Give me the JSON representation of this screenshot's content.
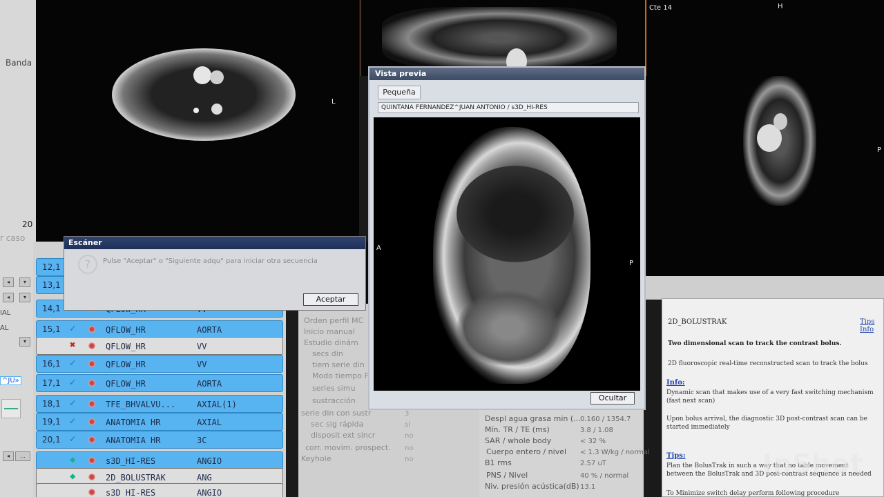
{
  "left_strip": {
    "banda_label": "Banda",
    "num_20": "20",
    "caso_label": "r caso",
    "axial_label": "IAL",
    "al_label": "AL",
    "ju_label": "^JU»"
  },
  "viewports": {
    "axial": {
      "orient_label": "L"
    },
    "sagittal": {
      "orient_left": "A",
      "orient_right": "P"
    },
    "right": {
      "corner_label": "Cte 14",
      "top_label": "H",
      "orient_right": "P"
    }
  },
  "vista_previa": {
    "title": "Vista previa",
    "tab": "Pequeña",
    "patient": "QUINTANA FERNANDEZ^JUAN ANTONIO / s3D_HI-RES",
    "hide_button": "Ocultar"
  },
  "escaner": {
    "title": "Escáner",
    "message": "Pulse \"Aceptar\" o \"Siguiente adqu\" para iniciar otra secuencia",
    "accept_button": "Aceptar"
  },
  "scan_rows": [
    {
      "num": "12,1",
      "status": "",
      "name": "",
      "tag": "",
      "selected": true
    },
    {
      "num": "13,1",
      "status": "",
      "name": "",
      "tag": "",
      "selected": true
    },
    {
      "num": "14,1",
      "status": "✓",
      "name": "QFLOW_HR",
      "tag": "VV",
      "selected": true
    },
    {
      "num": "15,1",
      "status": "✓",
      "name": "QFLOW_HR",
      "tag": "AORTA",
      "selected": true
    },
    {
      "num": "",
      "status": "✖",
      "name": "QFLOW_HR",
      "tag": "VV",
      "selected": false
    },
    {
      "num": "16,1",
      "status": "✓",
      "name": "QFLOW_HR",
      "tag": "VV",
      "selected": true
    },
    {
      "num": "17,1",
      "status": "✓",
      "name": "QFLOW_HR",
      "tag": "AORTA",
      "selected": true
    },
    {
      "num": "18,1",
      "status": "✓",
      "name": "TFE_BHVALVU...",
      "tag": "AXIAL(1)",
      "selected": true
    },
    {
      "num": "19,1",
      "status": "✓",
      "name": "ANATOMIA HR",
      "tag": "AXIAL",
      "selected": true
    },
    {
      "num": "20,1",
      "status": "✓",
      "name": "ANATOMIA HR",
      "tag": "3C",
      "selected": true
    },
    {
      "num": "",
      "status": "◆",
      "name": "s3D_HI-RES",
      "tag": "ANGIO",
      "selected": true
    },
    {
      "num": "",
      "status": "◆",
      "name": "2D_BOLUSTRAK",
      "tag": "ANG",
      "selected": false
    },
    {
      "num": "",
      "status": "",
      "name": "s3D_HI-RES",
      "tag": "ANGIO",
      "selected": false
    }
  ],
  "params_left": [
    "Orden perfil MC",
    "Inicio manual",
    "Estudio dinám",
    "secs din",
    "tiem serie din",
    "Modo tiempo F",
    "series simu",
    "sustracción",
    "serie din con sustr",
    "sec sig rápida",
    "disposit ext sincr",
    "corr. movim. prospect.",
    "Keyhole"
  ],
  "params_left_vals": [
    "3",
    "sí",
    "no",
    "no",
    "no"
  ],
  "params_right": [
    {
      "label": "Despl agua grasa min (...",
      "value": "0.160 / 1354.7"
    },
    {
      "label": "Mín. TR / TE (ms)",
      "value": "3.8 / 1.08"
    },
    {
      "label": "SAR / whole body",
      "value": "< 32 %"
    },
    {
      "label": "Cuerpo entero / nivel",
      "value": "< 1.3 W/kg / normal"
    },
    {
      "label": "B1 rms",
      "value": "2.57 uT"
    },
    {
      "label": "PNS / Nivel",
      "value": "40 % / normal"
    },
    {
      "label": "Niv. presión acústica(dB)",
      "value": "13.1"
    }
  ],
  "help": {
    "title": "2D_BOLUSTRAK",
    "tips_link": "Tips Info",
    "subtitle": "Two dimensional scan to track the contrast bolus.",
    "desc": "2D fluoroscopic real-time reconstructed scan to track the bolus",
    "info_label": "Info:",
    "info_text": "Dynamic scan that makes use of a very fast switching mechanism (fast next scan)",
    "info_text2": "Upon bolus arrival, the diagnostic 3D post-contrast scan can be started immediately",
    "tips_label": "Tips:",
    "tips_text": "Plan the BolusTrak in such a way that no table movement between the BolusTrak and 3D post-contrast sequence is needed",
    "tips_text2": "To Minimize switch delay perform following procedure"
  },
  "watermark": "InShot",
  "colors": {
    "selected_row": "#58b4f0",
    "check": "#1a6fd6",
    "error": "#d02020",
    "diamond": "#18b08a"
  }
}
